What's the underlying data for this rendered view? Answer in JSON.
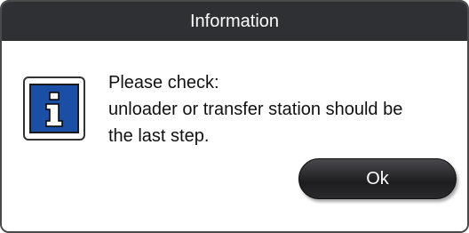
{
  "dialog": {
    "title": "Information",
    "message_lines": [
      "Please check:",
      "unloader or transfer station should be",
      "the last step."
    ],
    "icon": "info-icon",
    "ok_label": "Ok"
  },
  "colors": {
    "title_bar": "#2f3033",
    "icon_blue": "#1b4fa6",
    "button": "#1c1c1f"
  }
}
